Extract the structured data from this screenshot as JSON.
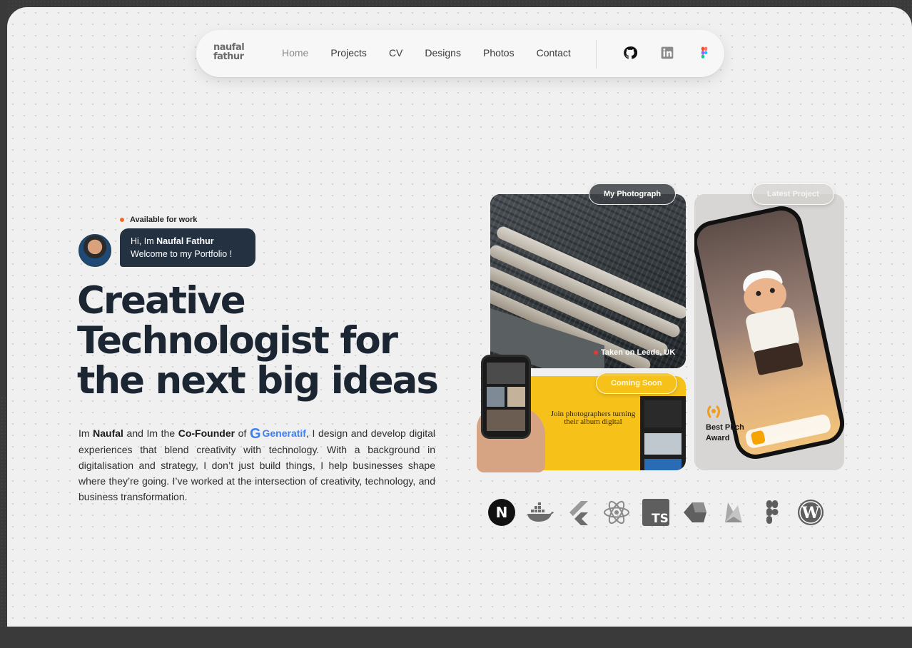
{
  "nav": {
    "logo_line1": "naufal",
    "logo_line2": "fathur",
    "links": [
      "Home",
      "Projects",
      "CV",
      "Designs",
      "Photos",
      "Contact"
    ],
    "social_icons": [
      "github-icon",
      "linkedin-icon",
      "figma-icon"
    ]
  },
  "hero": {
    "availability": "Available for work",
    "greeting_prefix": "Hi, Im ",
    "greeting_name": "Naufal Fathur",
    "greeting_line2": "Welcome to my Portfolio !",
    "headline_lines": [
      "Creative",
      "Technologist for",
      "the next big ideas"
    ],
    "intro": {
      "p1": "Im ",
      "name": "Naufal",
      "p2": " and Im the ",
      "role": "Co-Founder",
      "p3": " of ",
      "company": "Generatif",
      "p4": ", I design and develop digital experiences that blend creativity with technology. With a background in digitalisation and strategy, I don’t just build things, I help businesses shape where they’re going. I’ve worked at the intersection of creativity, technology, and business transformation."
    }
  },
  "cards": {
    "photo_label": "My Photograph",
    "photo_caption": "Taken on Leeds, UK",
    "project_label": "Latest Project",
    "award_line1": "Best Pitch",
    "award_line2": "Award",
    "soon_label": "Coming Soon",
    "soon_text": "Join photographers turning their album digital"
  },
  "tech_icons": [
    "nextjs-icon",
    "docker-icon",
    "flutter-icon",
    "react-icon",
    "typescript-icon",
    "dart-icon",
    "firebase-icon",
    "figma-icon",
    "wordpress-icon"
  ],
  "colors": {
    "accent_orange": "#f26b21",
    "brand_blue": "#3d7ff5",
    "text_dark": "#1c2633",
    "soon_yellow": "#f6c21a"
  }
}
